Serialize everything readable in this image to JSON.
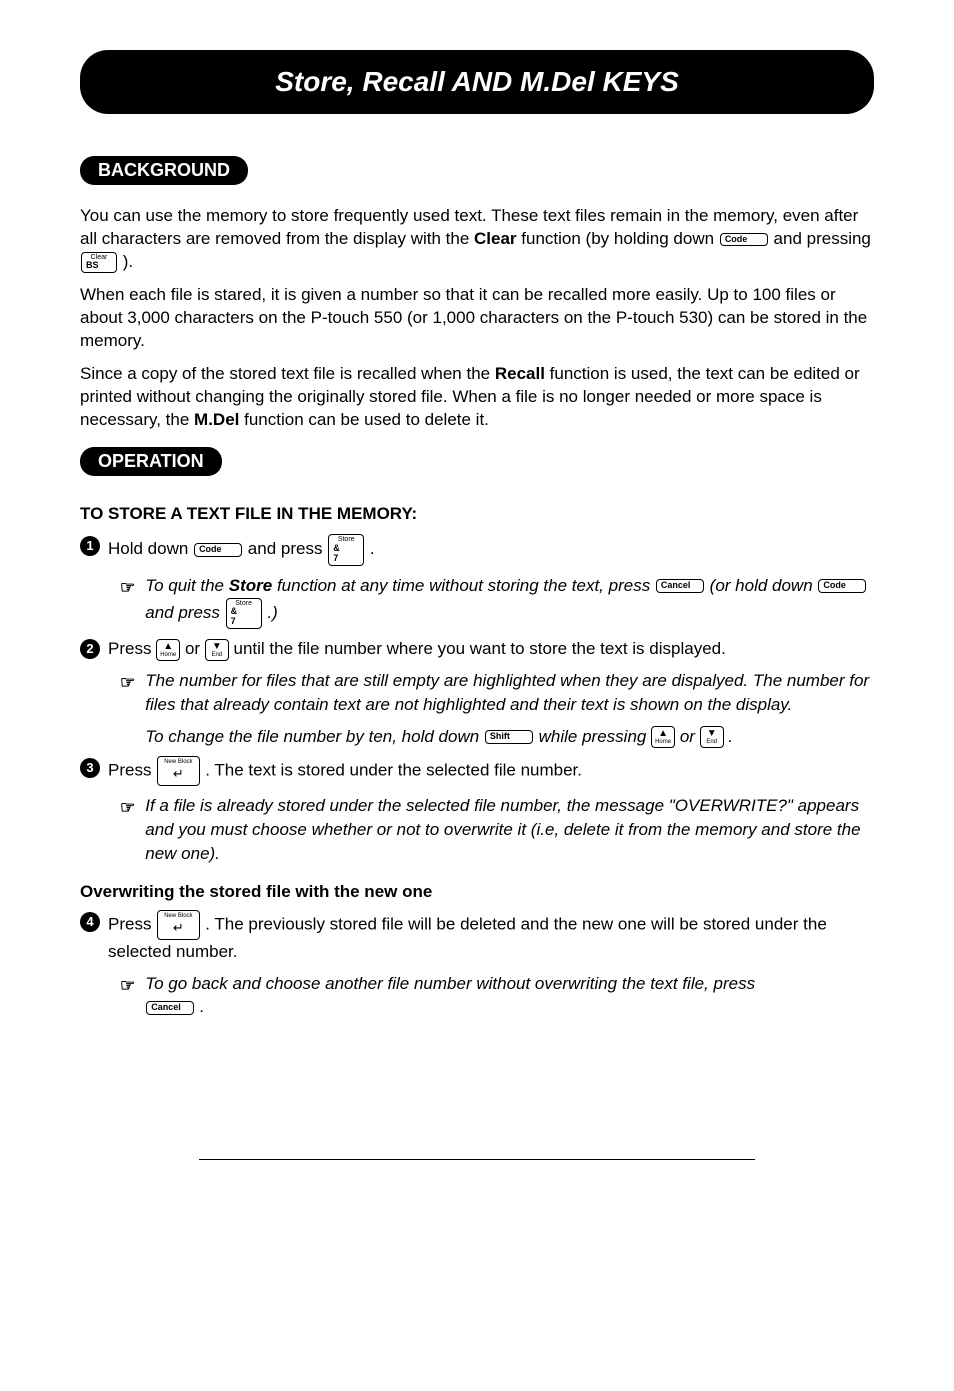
{
  "title": "Store, Recall AND M.Del KEYS",
  "sections": {
    "background": {
      "label": "BACKGROUND",
      "p1a": "You can use the memory to store frequently used text.  These text files remain in the memory, even after all characters are removed from the display with the ",
      "p1_clear": "Clear",
      "p1b": " function (by holding down ",
      "p1c": " and pressing ",
      "p1d": " ).",
      "p2": "When each file is stared, it is given a number so that it can be recalled more easily.  Up to 100 files or about 3,000 characters on the P-touch 550 (or 1,000 characters on the P-touch 530) can be stored in the memory.",
      "p3a": "Since a copy of the stored text file is recalled when the ",
      "p3_recall": "Recall",
      "p3b": " function is used, the text can be edited or printed without changing the originally stored file.  When a file is no longer needed or more space is necessary, the ",
      "p3_mdel": "M.Del",
      "p3c": " function can be used to delete it."
    },
    "operation": {
      "label": "OPERATION",
      "subhead": "TO STORE A TEXT FILE IN THE MEMORY:",
      "step1a": "Hold down ",
      "step1b": " and press ",
      "step1c": " .",
      "note1a": "To quit the ",
      "note1_store": "Store",
      "note1b": " function at any time without storing the text, press ",
      "note1c": " (or hold down ",
      "note1d": " and press ",
      "note1e": " .)",
      "step2a": "Press ",
      "step2b": " or ",
      "step2c": " until the file number where you want to store the text is displayed.",
      "note2a": "The number for files that are still empty are highlighted when they are dispalyed.  The number for files that already contain text are not highlighted and their text is shown on the display.",
      "note2b_a": "To change the file number by ten, hold down ",
      "note2b_b": " while pressing ",
      "note2b_c": " or ",
      "note2b_d": " .",
      "step3a": "Press ",
      "step3b": ".  The text is stored under the selected file number.",
      "note3": "If a file is already stored under the selected file number, the message \"OVERWRITE?\" appears and you must choose whether or not to overwrite it (i.e, delete it from the memory and store the new one).",
      "subhead2": "Overwriting the stored file with the new one",
      "step4a": "Press ",
      "step4b": ".  The previously stored file will be deleted and the new one will be stored under the selected number.",
      "note4a": "To go back and choose another file number without overwriting the text file, press ",
      "note4b": " ."
    }
  },
  "keys": {
    "code": "Code",
    "bs_top": "Clear",
    "bs": "BS",
    "store_top": "Store",
    "store_amp": "&",
    "store_seven": "7",
    "cancel": "Cancel",
    "home": "Home",
    "end": "End",
    "shift": "Shift",
    "newblock": "New Block",
    "enter_arrow": "↵"
  },
  "nums": {
    "s1": "1",
    "s2": "2",
    "s3": "3",
    "s4": "4"
  },
  "pointer": "☞"
}
